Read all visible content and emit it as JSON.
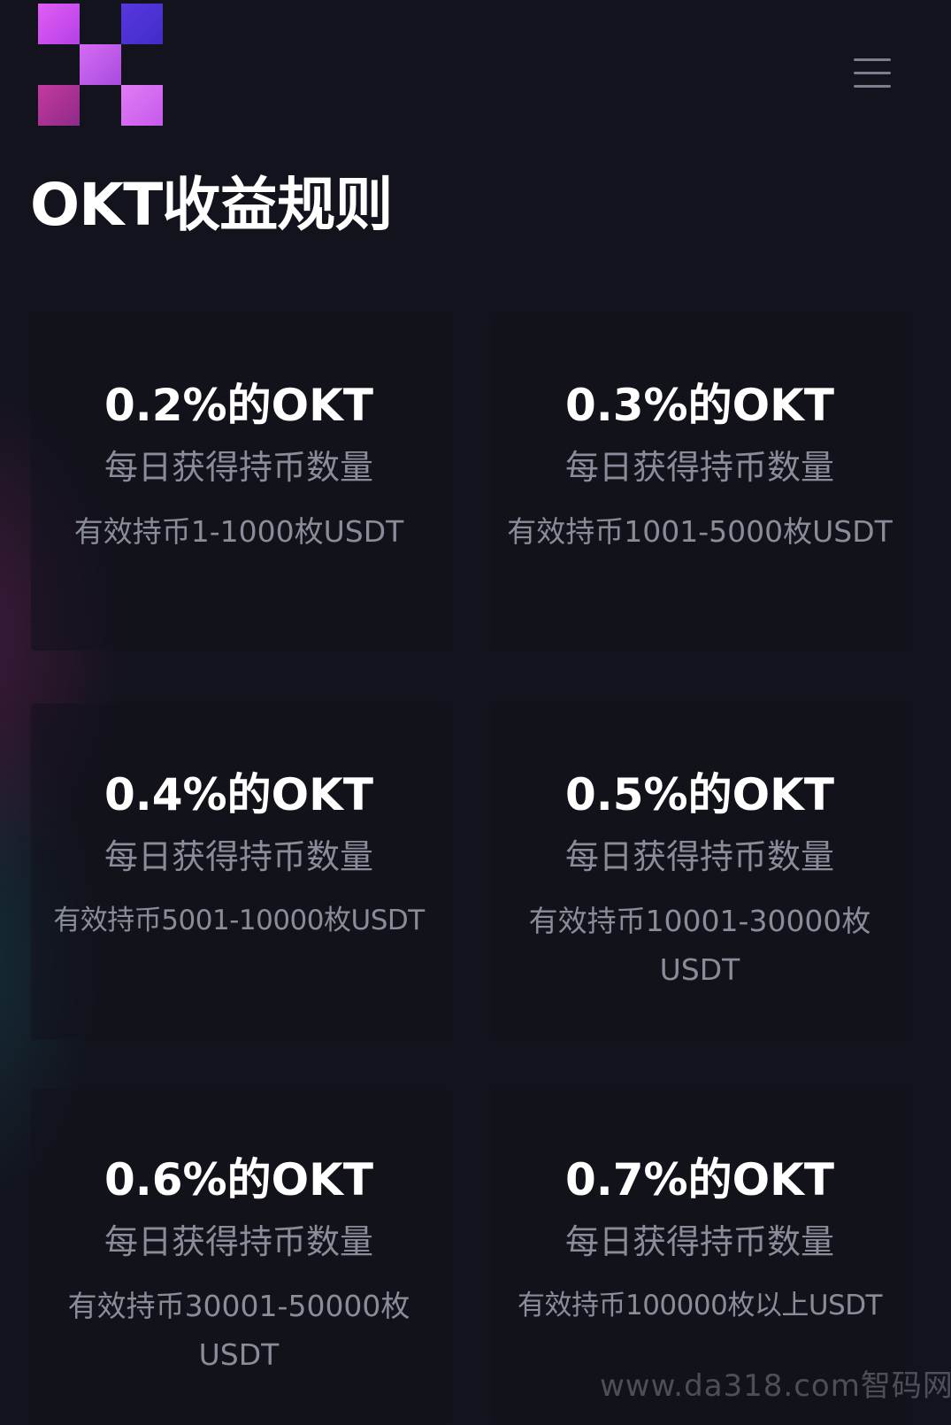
{
  "header": {
    "logo": "okx-logo",
    "menu_icon": "hamburger-menu-icon"
  },
  "page_title": "OKT收益规则",
  "cards": [
    {
      "rate": "0.2%的OKT",
      "desc": "每日获得持币数量",
      "range": "有效持币1-1000枚USDT"
    },
    {
      "rate": "0.3%的OKT",
      "desc": "每日获得持币数量",
      "range": "有效持币1001-5000枚USDT"
    },
    {
      "rate": "0.4%的OKT",
      "desc": "每日获得持币数量",
      "range": "有效持币5001-10000枚USDT"
    },
    {
      "rate": "0.5%的OKT",
      "desc": "每日获得持币数量",
      "range": "有效持币10001-30000枚USDT"
    },
    {
      "rate": "0.6%的OKT",
      "desc": "每日获得持币数量",
      "range": "有效持币30001-50000枚USDT"
    },
    {
      "rate": "0.7%的OKT",
      "desc": "每日获得持币数量",
      "range": "有效持币100000枚以上USDT"
    }
  ],
  "watermark": "www.da318.com智码网",
  "colors": {
    "background": "#12131c",
    "title": "#ffffff",
    "muted_text": "#8a8c99",
    "logo_magenta": "#e35cf5",
    "logo_indigo": "#5a37e0"
  }
}
